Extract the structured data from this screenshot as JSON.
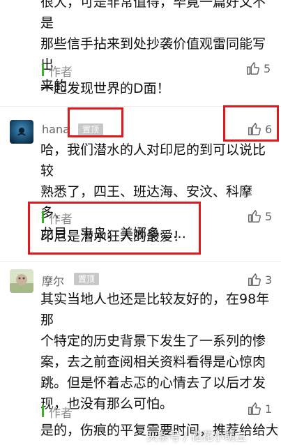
{
  "comment_top": {
    "text_lines": [
      "很大，可是非常值得，毕竟一篇好文不是",
      "那些信手拈来到处抄袭价值观雷同能写出",
      "来的"
    ],
    "reply": {
      "author": "作者",
      "text": "一起发现世界的D面！",
      "likes": "5"
    }
  },
  "comment_hana": {
    "username": "hana",
    "pin_badge": "置顶",
    "likes": "6",
    "text_lines": [
      "哈，我们潜水的人对印尼的到可以说比较",
      "熟悉了，四王、班达海、安汶、科摩多、",
      "龙目、韦岛、美娜多……"
    ],
    "reply": {
      "author": "作者",
      "text": "印尼是潜水狂人的最爱！",
      "likes": "5"
    }
  },
  "comment_moer": {
    "username": "摩尔",
    "pin_badge": "置顶",
    "likes": "3",
    "text_lines": [
      "其实当地人也还是比较友好的，在98年那",
      "个特定的历史背景下发生了一系列的惨",
      "案，去之前查阅相关资料看得是心惊肉",
      "跳。但是怀着忐忑的心情去了以后才发",
      "现，也没有那么可怕。"
    ],
    "reply": {
      "author": "作者",
      "text": "是的，伤痕的平复需要时间，推荐给给大",
      "likes": "1"
    }
  },
  "watermark": "头条号 / 花花小萌主",
  "colors": {
    "accent_green": "#3fae2a",
    "highlight_red": "#e0191e",
    "badge_gray": "#c8c8c8"
  }
}
